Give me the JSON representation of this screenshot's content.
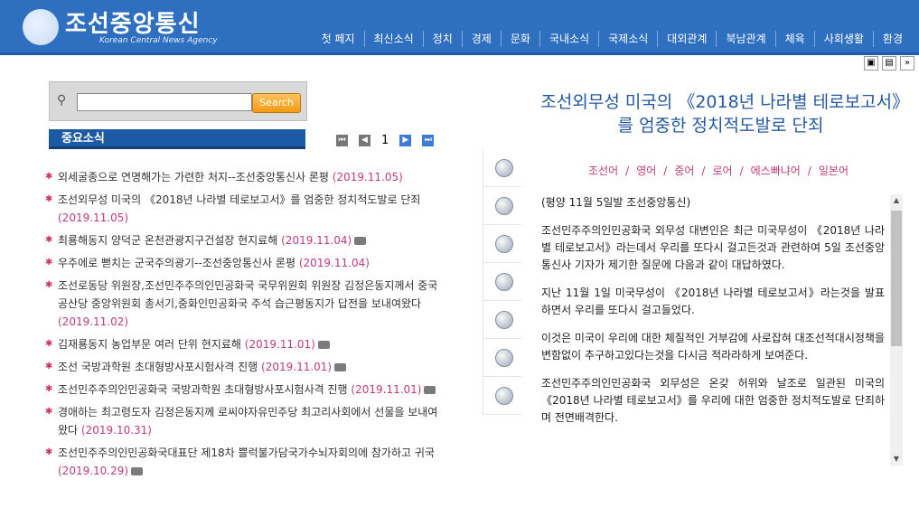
{
  "header": {
    "logo_text": "조선중앙통신",
    "logo_sub": "Korean Central News Agency",
    "nav": [
      "첫 페지",
      "최신소식",
      "정치",
      "경제",
      "문화",
      "국내소식",
      "국제소식",
      "대외관계",
      "북남관계",
      "체육",
      "사회생활",
      "환경"
    ]
  },
  "search": {
    "placeholder": "",
    "button": "Search"
  },
  "news_header": "중요소식",
  "pager": {
    "current": "1"
  },
  "news": [
    {
      "text": "외세굴종으로 연명해가는 가련한 처지--조선중앙통신사 론평",
      "date": "(2019.11.05)",
      "cam": false
    },
    {
      "text": "조선외무성 미국의 《2018년 나라별 테로보고서》를 엄중한 정치적도발로 단죄",
      "date": "(2019.11.05)",
      "cam": false
    },
    {
      "text": "최룡해동지 양덕군 온천관광지구건설장 현지료해",
      "date": "(2019.11.04)",
      "cam": true
    },
    {
      "text": "우주에로 뻗치는 군국주의광기--조선중앙통신사 론평",
      "date": "(2019.11.04)",
      "cam": false
    },
    {
      "text": "조선로동당 위원장,조선민주주의인민공화국 국무위원회 위원장 김정은동지께서 중국공산당 중앙위원회 총서기,중화인민공화국 주석 습근평동지가 답전을 보내여왔다",
      "date": "(2019.11.02)",
      "cam": false
    },
    {
      "text": "김재룡동지 농업부문 여러 단위 현지료해",
      "date": "(2019.11.01)",
      "cam": true
    },
    {
      "text": "조선 국방과학원 초대형방사포시험사격 진행",
      "date": "(2019.11.01)",
      "cam": true
    },
    {
      "text": "조선민주주의인민공화국 국방과학원 초대형방사포시험사격 진행",
      "date": "(2019.11.01)",
      "cam": true
    },
    {
      "text": "경애하는 최고령도자 김정은동지께 로씨야자유민주당 최고리사회에서 선물을 보내여왔다",
      "date": "(2019.10.31)",
      "cam": false
    },
    {
      "text": "조선민주주의인민공화국대표단 제18차 쁠럭불가담국가수뇌자회의에 참가하고 귀국",
      "date": "(2019.10.29)",
      "cam": true
    }
  ],
  "side_icons": [
    "print-icon",
    "video-icon",
    "photo-icon",
    "audio-icon",
    "share-icon",
    "email-icon",
    "back-icon"
  ],
  "article": {
    "title": "조선외무성 미국의 《2018년 나라별 테로보고서》를 엄중한 정치적도발로 단죄",
    "languages": [
      "조선어",
      "영어",
      "중어",
      "로어",
      "에스빠냐어",
      "일본어"
    ],
    "paragraphs": [
      "(평양 11월 5일발 조선중앙통신)",
      "조선민주주의인민공화국 외무성 대변인은 최근 미국무성이 《2018년 나라별 테로보고서》라는데서 우리를 또다시 걸고든것과 관련하여 5일 조선중앙통신사 기자가 제기한 질문에 다음과 같이 대답하였다.",
      "지난 11월 1일 미국무성이 《2018년 나라별 테로보고서》라는것을 발표하면서 우리를 또다시 걸고들었다.",
      "이것은 미국이 우리에 대한 체질적인 거부감에 사로잡혀 대조선적대시정책을 변함없이 추구하고있다는것을 다시금 적라라하게 보여준다.",
      "조선민주주의인민공화국 외무성은 온갖 허위와 날조로 일관된 미국의 《2018년 나라별 테로보고서》를 우리에 대한 엄중한 정치적도발로 단죄하며 전면배격한다."
    ]
  }
}
